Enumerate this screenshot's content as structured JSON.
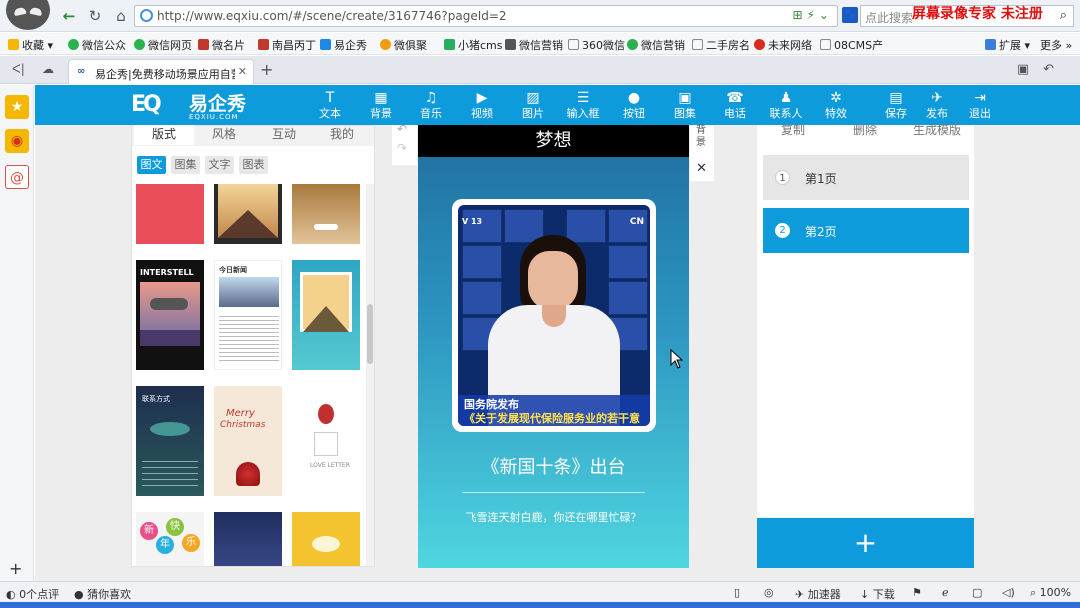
{
  "browser": {
    "url": "http://www.eqxiu.com/#/scene/create/3167746?pageId=2",
    "search_placeholder": "点此搜索",
    "watermark": "屏幕录像专家  未注册",
    "bookmarks": [
      "收藏",
      "微信公众",
      "微信网页",
      "微名片",
      "南昌丙丁",
      "易企秀",
      "微俱聚",
      "小猪cms",
      "微信营销",
      "360微信",
      "微信营销",
      "二手房名",
      "未来网络",
      "08CMS产"
    ],
    "bookmark_extension": "扩展",
    "bookmark_more": "更多",
    "active_tab_title": "易企秀|免费移动场景应用自营销管家"
  },
  "app": {
    "brand_name": "易企秀",
    "brand_domain": "EQXIU.COM",
    "toolbar": [
      {
        "label": "文本",
        "icon": "text-icon"
      },
      {
        "label": "背景",
        "icon": "grid-icon"
      },
      {
        "label": "音乐",
        "icon": "music-icon"
      },
      {
        "label": "视频",
        "icon": "video-icon"
      },
      {
        "label": "图片",
        "icon": "image-icon"
      },
      {
        "label": "输入框",
        "icon": "list-icon"
      },
      {
        "label": "按钮",
        "icon": "button-icon"
      },
      {
        "label": "图集",
        "icon": "gallery-icon"
      },
      {
        "label": "电话",
        "icon": "phone-icon"
      },
      {
        "label": "联系人",
        "icon": "contact-icon"
      },
      {
        "label": "特效",
        "icon": "sparkle-icon"
      },
      {
        "label": "保存",
        "icon": "save-icon"
      },
      {
        "label": "发布",
        "icon": "publish-icon"
      },
      {
        "label": "退出",
        "icon": "exit-icon"
      }
    ],
    "left_panel": {
      "tabs": [
        "版式",
        "风格",
        "互动",
        "我的"
      ],
      "active_tab": "版式",
      "sub_tabs": [
        "图文",
        "图集",
        "文字",
        "图表"
      ],
      "active_sub_tab": "图文",
      "template_texts": {
        "interstellar": "INTERSTELL",
        "news_today": "今日新闻",
        "contact": "联系方式",
        "merry": "Merry",
        "christmas": "Christmas",
        "love_letter": "LOVE LETTER",
        "new_year": [
          "新",
          "年",
          "快",
          "乐"
        ]
      }
    },
    "phone": {
      "header": "梦想",
      "ticker_line1": "国务院发布",
      "ticker_line2": "《关于发展现代保险服务业的若干意",
      "channel_left": "V 13",
      "channel_right": "CN",
      "title": "《新国十条》出台",
      "subtitle": "飞雪连天射白鹿，你还在哪里忙碌？"
    },
    "page_strip_label": "背景",
    "right_panel": {
      "actions": [
        "复制",
        "删除",
        "生成模版"
      ],
      "pages": [
        {
          "num": "1",
          "label": "第1页",
          "active": false
        },
        {
          "num": "2",
          "label": "第2页",
          "active": true
        }
      ],
      "add_label": "+"
    }
  },
  "statusbar": {
    "comments": "0个点评",
    "guess": "猜你喜欢",
    "accelerator": "加速器",
    "download": "下载",
    "zoom": "100%"
  },
  "colors": {
    "accent": "#0e9bdc",
    "watermark": "#e01010"
  }
}
